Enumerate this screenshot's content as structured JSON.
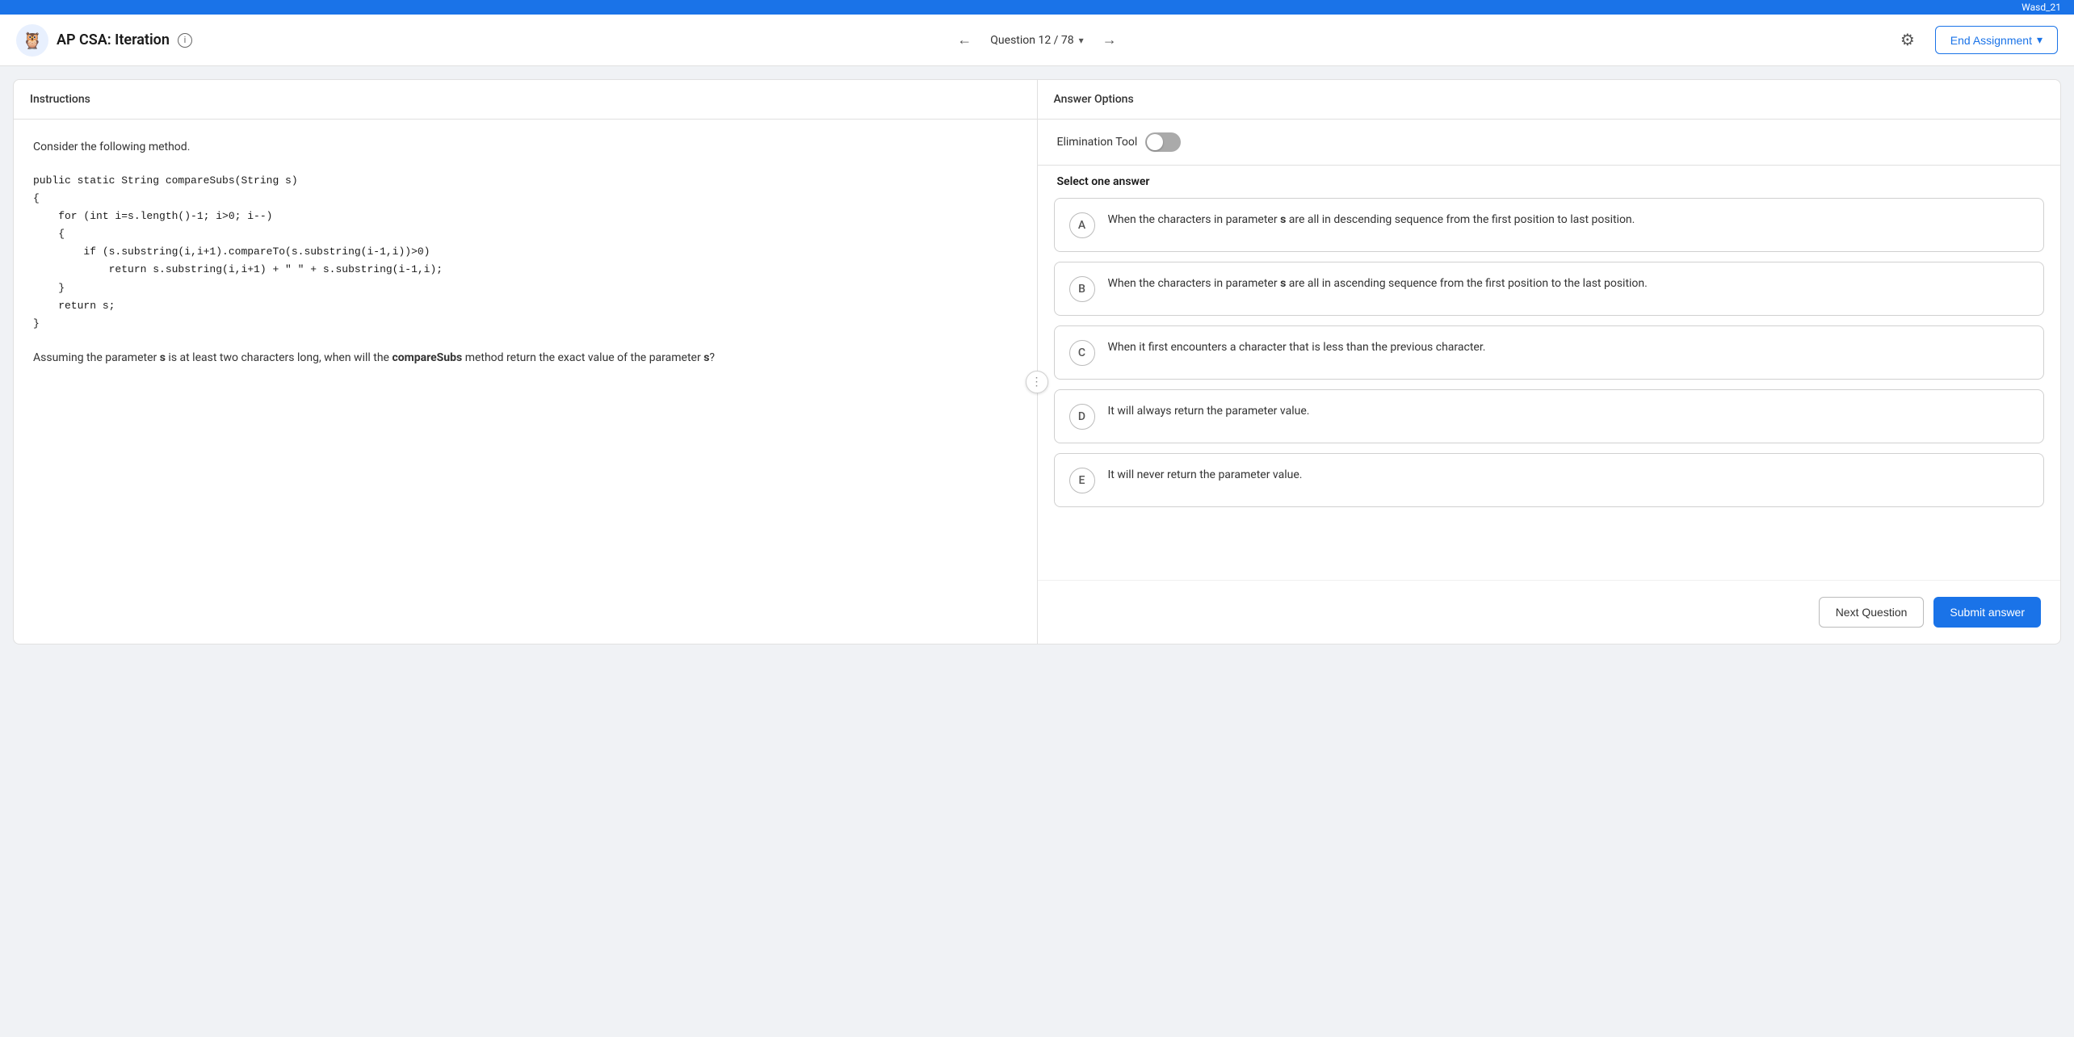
{
  "username_bar": {
    "username": "Wasd_21"
  },
  "header": {
    "logo_emoji": "🦉",
    "title": "AP CSA: Iteration",
    "info_label": "i",
    "question_nav": {
      "label": "Question 12 / 78"
    },
    "gear_icon": "⚙",
    "end_assignment": "End Assignment",
    "chevron": "▾",
    "prev_arrow": "←",
    "next_arrow": "→"
  },
  "left_panel": {
    "header": "Instructions",
    "intro_text": "Consider the following method.",
    "code": "public static String compareSubs(String s)\n{\n    for (int i=s.length()-1; i>0; i--)\n    {\n        if (s.substring(i,i+1).compareTo(s.substring(i-1,i))>0)\n            return s.substring(i,i+1) + \" \" + s.substring(i-1,i);\n    }\n    return s;\n}",
    "question_text_parts": {
      "before_bold1": "Assuming the parameter ",
      "bold1": "s",
      "mid1": " is at least two characters long, when will the ",
      "bold2": "compareSubs",
      "mid2": " method return the exact value of the parameter ",
      "bold3": "s",
      "after": "?"
    }
  },
  "right_panel": {
    "header": "Answer Options",
    "elimination_tool_label": "Elimination Tool",
    "select_label": "Select one answer",
    "answers": [
      {
        "letter": "A",
        "text_parts": {
          "before": "When the characters in parameter ",
          "bold": "s",
          "after": " are all in descending sequence from the first position to last position."
        }
      },
      {
        "letter": "B",
        "text_parts": {
          "before": "When the characters in parameter ",
          "bold": "s",
          "after": " are all in ascending sequence from the first position to the last position."
        }
      },
      {
        "letter": "C",
        "text": "When it first encounters a character that is less than the previous character."
      },
      {
        "letter": "D",
        "text": "It will always return the parameter value."
      },
      {
        "letter": "E",
        "text": "It will never return the parameter value."
      }
    ],
    "next_question_label": "Next Question",
    "submit_answer_label": "Submit answer"
  }
}
